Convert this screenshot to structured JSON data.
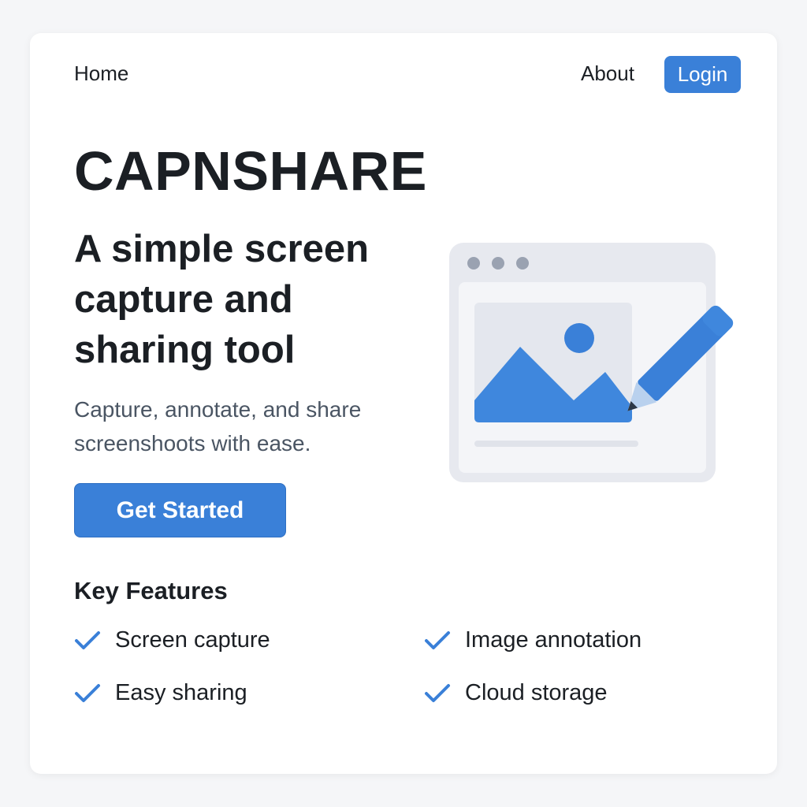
{
  "nav": {
    "home_label": "Home",
    "about_label": "About",
    "login_label": "Login"
  },
  "hero": {
    "brand": "CAPNSHARE",
    "headline": "A simple screen capture and sharing tool",
    "tagline": "Capture, annotate, and share screenshoots with ease.",
    "cta_label": "Get Started",
    "illustration_icon": "image-edit-illustration"
  },
  "features": {
    "title": "Key Features",
    "check_icon": "checkmark-icon",
    "items": [
      {
        "label": "Screen capture"
      },
      {
        "label": "Image annotation"
      },
      {
        "label": "Easy sharing"
      },
      {
        "label": "Cloud storage"
      }
    ]
  },
  "colors": {
    "accent": "#3a80d8",
    "page_bg": "#f5f6f8",
    "card_bg": "#ffffff",
    "text_dark": "#1b1f24",
    "text_muted": "#4a5563"
  }
}
